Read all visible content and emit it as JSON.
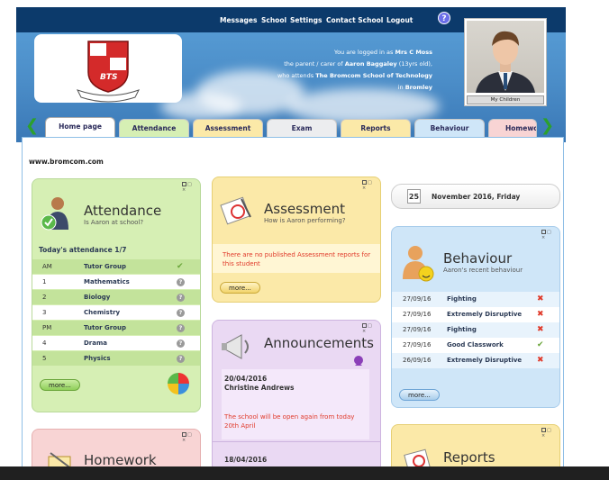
{
  "navbar": {
    "messages": "Messages",
    "school": "School",
    "settings": "Settings",
    "contact_school": "Contact School",
    "logout": "Logout",
    "help": "?"
  },
  "logo": {
    "text": "BTS"
  },
  "login_info": {
    "line1_pre": "You are logged in as",
    "user": "Mrs C Moss",
    "line2_pre": "the parent / carer of",
    "child": "Aaron Baggaley",
    "child_age": "(13yrs old),",
    "line3_pre": "who attends",
    "school": "The Bromcom School of Technology",
    "line4_pre": "in",
    "location": "Bromley"
  },
  "my_children": "My Children",
  "tabs": [
    {
      "label": "Home page",
      "color": "#ffffff"
    },
    {
      "label": "Attendance",
      "color": "#d6efb4"
    },
    {
      "label": "Assessment",
      "color": "#fbe9a8"
    },
    {
      "label": "Exam",
      "color": "#ecedef"
    },
    {
      "label": "Reports",
      "color": "#fbe9a8"
    },
    {
      "label": "Behaviour",
      "color": "#cfe6f8"
    },
    {
      "label": "Homewo",
      "color": "#f8d4d4"
    }
  ],
  "site_url": "www.bromcom.com",
  "attendance": {
    "title": "Attendance",
    "subtitle": "Is Aaron at school?",
    "today_label": "Today's attendance 1/7",
    "rows": [
      {
        "period": "AM",
        "subject": "Tutor Group",
        "mark": "✔"
      },
      {
        "period": "1",
        "subject": "Mathematics",
        "mark": "?"
      },
      {
        "period": "2",
        "subject": "Biology",
        "mark": "?"
      },
      {
        "period": "3",
        "subject": "Chemistry",
        "mark": "?"
      },
      {
        "period": "PM",
        "subject": "Tutor Group",
        "mark": "?"
      },
      {
        "period": "4",
        "subject": "Drama",
        "mark": "?"
      },
      {
        "period": "5",
        "subject": "Physics",
        "mark": "?"
      }
    ],
    "more": "more..."
  },
  "assessment": {
    "title": "Assessment",
    "subtitle": "How is Aaron performing?",
    "message": "There are no published Assessment reports for this student",
    "more": "more..."
  },
  "date_widget": {
    "day": "25",
    "text": "November 2016, Friday"
  },
  "behaviour": {
    "title": "Behaviour",
    "subtitle": "Aaron's recent behaviour",
    "rows": [
      {
        "date": "27/09/16",
        "name": "Fighting",
        "mark": "✖",
        "positive": false
      },
      {
        "date": "27/09/16",
        "name": "Extremely Disruptive",
        "mark": "✖",
        "positive": false
      },
      {
        "date": "27/09/16",
        "name": "Fighting",
        "mark": "✖",
        "positive": false
      },
      {
        "date": "27/09/16",
        "name": "Good Classwork",
        "mark": "✔",
        "positive": true
      },
      {
        "date": "26/09/16",
        "name": "Extremely Disruptive",
        "mark": "✖",
        "positive": false
      }
    ],
    "more": "more..."
  },
  "announcements": {
    "title": "Announcements",
    "items": [
      {
        "date": "20/04/2016",
        "author": "Christine Andrews",
        "text": "The school will be open again from today 20th April"
      },
      {
        "date": "18/04/2016",
        "author": "",
        "text": ""
      }
    ]
  },
  "homework": {
    "title": "Homework"
  },
  "reports": {
    "title": "Reports"
  },
  "panel_controls": "□ ×",
  "colors": {
    "nav": "#0c3a6b",
    "attendance": "#d6efb4",
    "assessment": "#fbe9a8",
    "announcements": "#ead9f3",
    "behaviour": "#cfe6f8",
    "homework": "#f8d4d4",
    "reports": "#fbe9a8",
    "alert": "#e03a2a"
  }
}
